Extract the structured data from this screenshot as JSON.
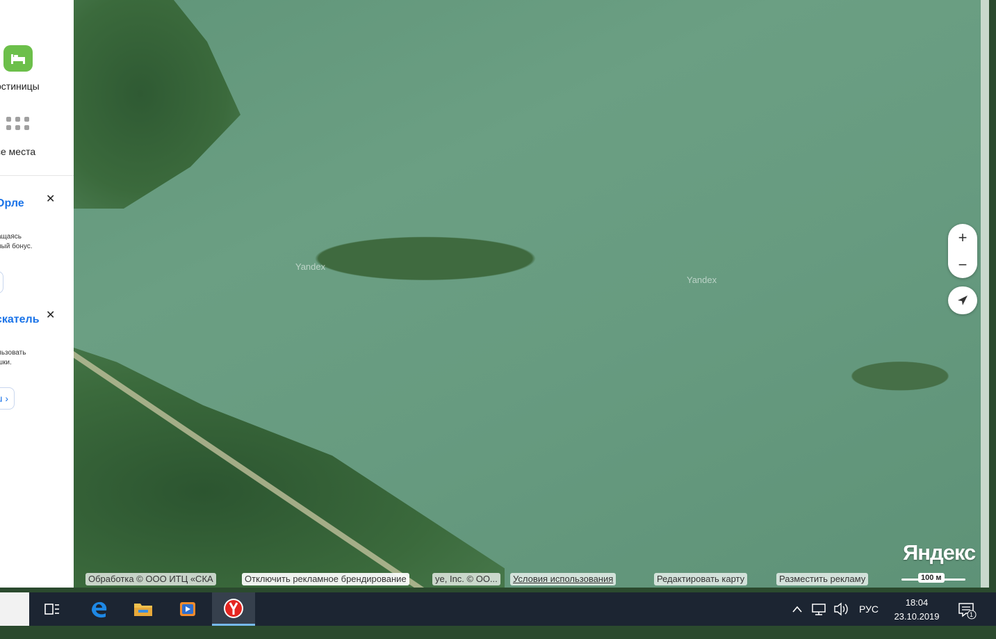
{
  "sidebar": {
    "categories": [
      {
        "label": "остиницы",
        "icon": "bed-icon",
        "color": "#6cbf4a"
      },
      {
        "label": "се места",
        "icon": "grid-dots-icon",
        "color": "#9a9a9a"
      }
    ],
    "promos": [
      {
        "title": "Орле",
        "text_line1": "ащаясь",
        "text_line2": "ный бонус.",
        "button": "›"
      },
      {
        "title": "скатель",
        "text_line1": "льзовать",
        "text_line2": "шки.",
        "button": "ru ›"
      }
    ]
  },
  "map": {
    "watermark_1": "Yandex",
    "watermark_2": "Yandex",
    "zoom_in": "+",
    "zoom_out": "−",
    "logo": "Яндекс",
    "copyright_1": "Обработка © ООО ИТЦ «СКА",
    "branding_toggle": "Отключить рекламное брендирование",
    "copyright_2": "ye, Inc. © ОО...",
    "terms_link": "Условия использования",
    "edit_map": "Редактировать карту",
    "place_ad": "Разместить рекламу",
    "scale_label": "100 м"
  },
  "taskbar": {
    "language": "РУС",
    "time": "18:04",
    "date": "23.10.2019",
    "notification_count": "1",
    "accent": "#76b9ed"
  }
}
